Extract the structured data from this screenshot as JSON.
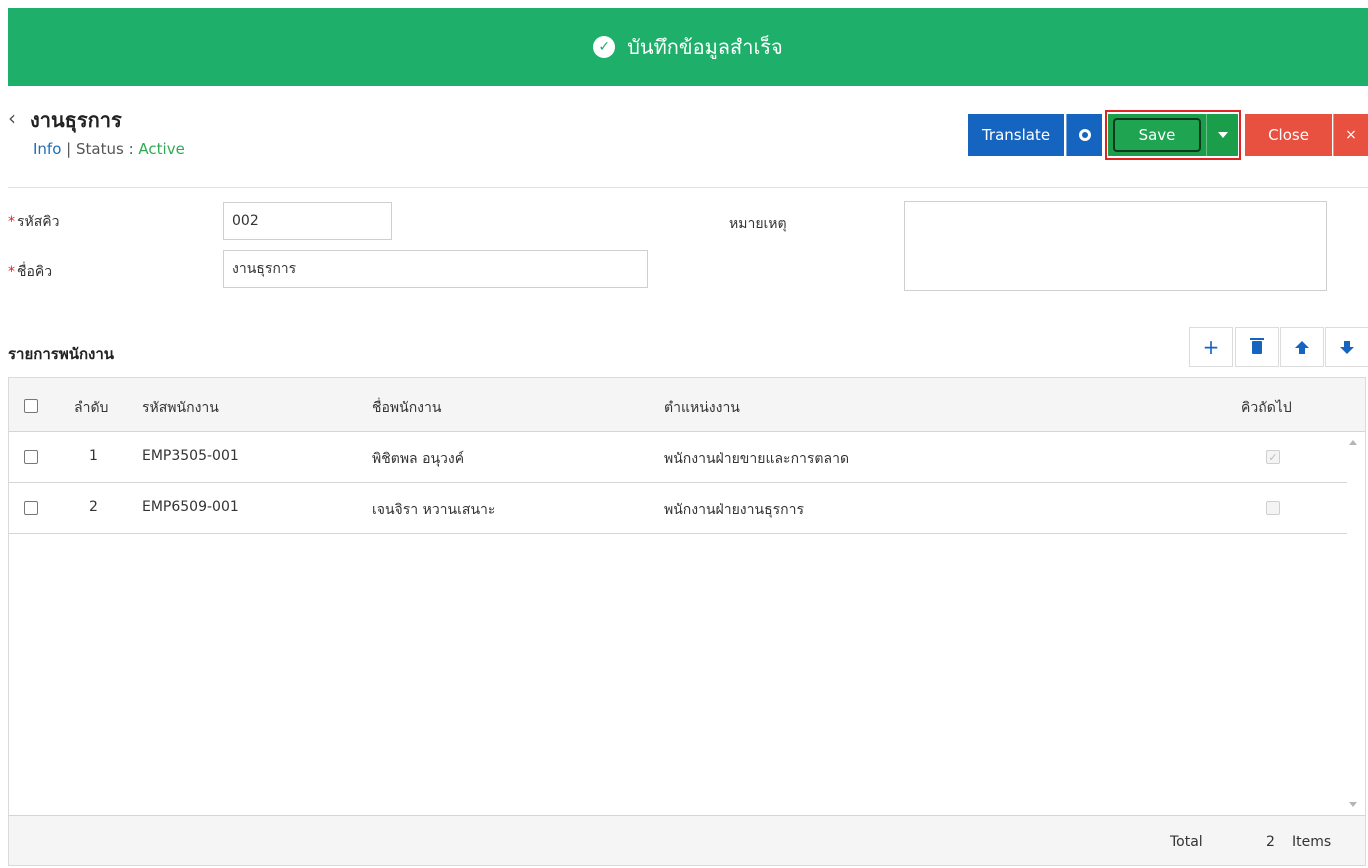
{
  "banner": {
    "message": "บันทึกข้อมูลสำเร็จ"
  },
  "header": {
    "title": "งานธุรการ",
    "info_label": "Info",
    "separator": "|",
    "status_label": "Status :",
    "status_value": "Active",
    "back_icon": "chevron-left-icon"
  },
  "toolbar": {
    "translate_label": "Translate",
    "save_label": "Save",
    "close_label": "Close",
    "close_x": "×"
  },
  "form": {
    "queue_code_label": "รหัสคิว",
    "queue_code_value": "002",
    "queue_name_label": "ชื่อคิว",
    "queue_name_value": "งานธุรการ",
    "remark_label": "หมายเหตุ",
    "remark_value": "",
    "required_mark": "*"
  },
  "list": {
    "title": "รายการพนักงาน",
    "tools": [
      "plus-icon",
      "trash-icon",
      "arrow-up-icon",
      "arrow-down-icon"
    ],
    "add_symbol": "+"
  },
  "table": {
    "columns": [
      "ลำดับ",
      "รหัสพนักงาน",
      "ชื่อพนักงาน",
      "ตำแหน่งงาน",
      "คิวถัดไป"
    ],
    "rows": [
      {
        "no": "1",
        "code": "EMP3505-001",
        "name": "พิชิตพล อนุวงค์",
        "position": "พนักงานฝ่ายขายและการตลาด",
        "next": true
      },
      {
        "no": "2",
        "code": "EMP6509-001",
        "name": "เจนจิรา หวานเสนาะ",
        "position": "พนักงานฝ่ายงานธุรการ",
        "next": false
      }
    ],
    "footer": {
      "total_label": "Total",
      "count": "2",
      "items_label": "Items"
    }
  },
  "colors": {
    "banner": "#1eb06a",
    "translate": "#1565c0",
    "save": "#1a9e4a",
    "close": "#e8503f",
    "highlight": "#e02424"
  }
}
